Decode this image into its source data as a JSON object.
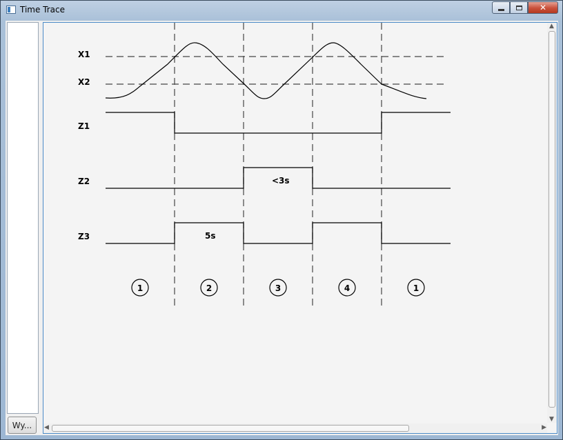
{
  "window": {
    "title": "Time Trace",
    "icon": "app-window-icon",
    "controls": {
      "minimize_icon": "minimize-icon",
      "maximize_icon": "maximize-icon",
      "close_icon": "close-icon"
    }
  },
  "sidebar": {
    "button_label": "Wy..."
  },
  "diagram": {
    "levels": {
      "x1": "X1",
      "x2": "X2"
    },
    "signals": {
      "z1": "Z1",
      "z2": "Z2",
      "z3": "Z3"
    },
    "annotations": {
      "z2_duration": "<3s",
      "z3_duration": "5s"
    },
    "phases": [
      "1",
      "2",
      "3",
      "4",
      "1"
    ]
  },
  "colors": {
    "accent_border": "#4a8ac7",
    "close_button": "#c9503a"
  }
}
